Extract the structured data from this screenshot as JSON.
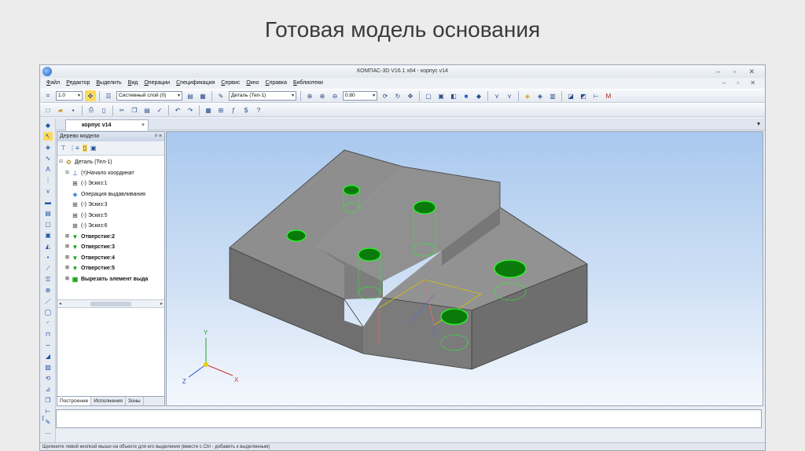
{
  "slide": {
    "title": "Готовая модель основания"
  },
  "window": {
    "title": "КОМПАС-3D V16.1 x64 - корпус v14",
    "controls": "– ▫ ✕",
    "mdi_controls": "– ▫ ✕"
  },
  "menu": [
    "Файл",
    "Редактор",
    "Выделить",
    "Вид",
    "Операции",
    "Спецификация",
    "Сервис",
    "Окно",
    "Справка",
    "Библиотеки"
  ],
  "toolbar": {
    "scale_value": "1.0",
    "layer_value": "Системный слой (0)",
    "detail_value": "Деталь (Тел-1)",
    "zoom_value": "0.80"
  },
  "document_tab": {
    "label": "корпус v14",
    "close": "×"
  },
  "model_tree": {
    "header": "Дерево модели",
    "pin": "ᵖ ×",
    "nodes": [
      {
        "label": "Деталь (Тел-1)",
        "indent": 0,
        "icon": "part-icon",
        "bold": false,
        "expander": "⊟"
      },
      {
        "label": "(т)Начало координат",
        "indent": 1,
        "icon": "origin-icon",
        "bold": false,
        "expander": "⊞"
      },
      {
        "label": "(-) Эскиз:1",
        "indent": 1,
        "icon": "sketch-icon",
        "bold": false,
        "expander": ""
      },
      {
        "label": "Операция выдавливания",
        "indent": 1,
        "icon": "extrude-icon",
        "bold": false,
        "expander": ""
      },
      {
        "label": "(-) Эскиз:3",
        "indent": 1,
        "icon": "sketch-icon",
        "bold": false,
        "expander": ""
      },
      {
        "label": "(-) Эскиз:5",
        "indent": 1,
        "icon": "sketch-icon",
        "bold": false,
        "expander": ""
      },
      {
        "label": "(-) Эскиз:6",
        "indent": 1,
        "icon": "sketch-icon",
        "bold": false,
        "expander": ""
      },
      {
        "label": "Отверстие:2",
        "indent": 1,
        "icon": "hole-icon",
        "bold": true,
        "expander": "⊞"
      },
      {
        "label": "Отверстие:3",
        "indent": 1,
        "icon": "hole-icon",
        "bold": true,
        "expander": "⊞"
      },
      {
        "label": "Отверстие:4",
        "indent": 1,
        "icon": "hole-icon",
        "bold": true,
        "expander": "⊞"
      },
      {
        "label": "Отверстие:5",
        "indent": 1,
        "icon": "hole-icon",
        "bold": true,
        "expander": "⊞"
      },
      {
        "label": "Вырезать элемент выда",
        "indent": 1,
        "icon": "cut-icon",
        "bold": true,
        "expander": "⊞"
      }
    ]
  },
  "bottom_tabs": [
    "Построение",
    "Исполнения",
    "Зоны"
  ],
  "axes": {
    "x": "X",
    "y": "Y",
    "z": "Z"
  },
  "status_text": "Щелкните левой кнопкой мыши на объекте для его выделения (вместе с Ctrl - добавить к выделенным)",
  "colors": {
    "model_face": "#8d8d8d",
    "hole_green": "#00cc00",
    "viewport_top": "#a9c8ee"
  }
}
